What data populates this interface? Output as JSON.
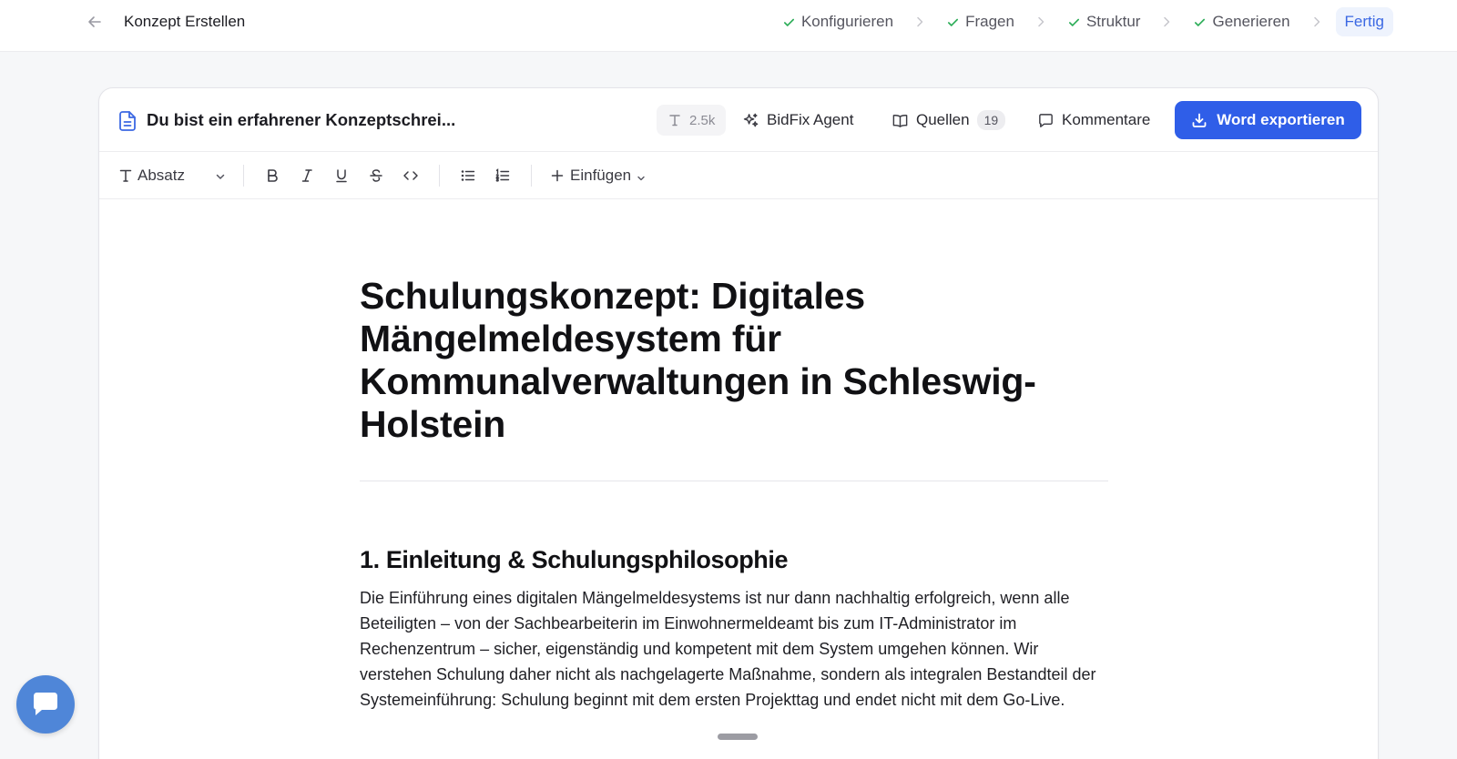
{
  "header": {
    "title": "Konzept Erstellen",
    "steps": [
      {
        "label": "Konfigurieren",
        "done": true
      },
      {
        "label": "Fragen",
        "done": true
      },
      {
        "label": "Struktur",
        "done": true
      },
      {
        "label": "Generieren",
        "done": true
      },
      {
        "label": "Fertig",
        "done": false,
        "active": true
      }
    ]
  },
  "doc_header": {
    "title": "Du bist ein erfahrener Konzeptschrei...",
    "token_count": "2.5k",
    "agent_label": "BidFix Agent",
    "sources_label": "Quellen",
    "sources_count": "19",
    "comments_label": "Kommentare",
    "export_label": "Word exportieren"
  },
  "toolbar": {
    "block_type": "Absatz",
    "insert_label": "Einfügen"
  },
  "document": {
    "h1": "Schulungskonzept: Digitales Mängelmeldesystem für Kommunalverwaltungen in Schleswig-Holstein",
    "h2": "1. Einleitung & Schulungsphilosophie",
    "p1": "Die Einführung eines digitalen Mängelmeldesystems ist nur dann nachhaltig erfolgreich, wenn alle Beteiligten – von der Sachbearbeiterin im Einwohnermeldeamt bis zum IT-Administrator im Rechenzentrum – sicher, eigenständig und kompetent mit dem System umgehen können. Wir verstehen Schulung daher nicht als nachgelagerte Maßnahme, sondern als integralen Bestandteil der Systemeinführung: Schulung beginnt mit dem ersten Projekttag und endet nicht mit dem Go-Live."
  },
  "colors": {
    "accent": "#2f5ee8",
    "success": "#2fae5a",
    "active_step_bg": "#eef3fd",
    "chat_launcher": "#4f86d8"
  },
  "icons": [
    "back-arrow-icon",
    "check-icon",
    "chevron-right-icon",
    "document-icon",
    "text-icon",
    "sparkles-icon",
    "book-open-icon",
    "comment-icon",
    "download-icon",
    "bold-icon",
    "italic-icon",
    "underline-icon",
    "strikethrough-icon",
    "code-icon",
    "bullet-list-icon",
    "ordered-list-icon",
    "plus-icon",
    "chat-icon"
  ]
}
